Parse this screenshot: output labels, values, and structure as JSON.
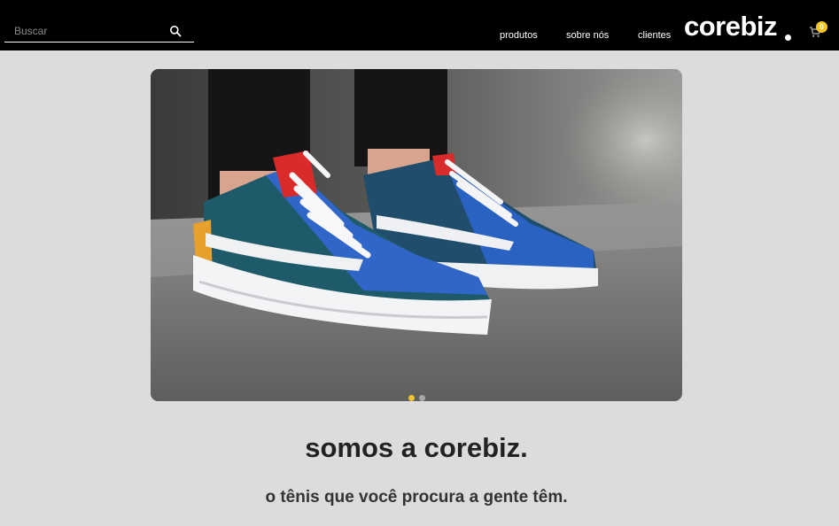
{
  "header": {
    "search": {
      "placeholder": "Buscar",
      "value": ""
    },
    "nav": [
      {
        "label": "produtos"
      },
      {
        "label": "sobre nós"
      },
      {
        "label": "clientes"
      }
    ],
    "logo_text": "corebiz",
    "cart_count": "0"
  },
  "banner": {
    "image_alt": "tênis colorido",
    "dots": [
      {
        "active": true,
        "color": "#f2c230"
      },
      {
        "active": false,
        "color": "#a8a8a8"
      }
    ]
  },
  "main": {
    "title": "somos a corebiz.",
    "subtitle": "o tênis que você procura a gente têm."
  },
  "colors": {
    "header_bg": "#000000",
    "page_bg": "#dcdcdc",
    "accent": "#f7c623"
  }
}
